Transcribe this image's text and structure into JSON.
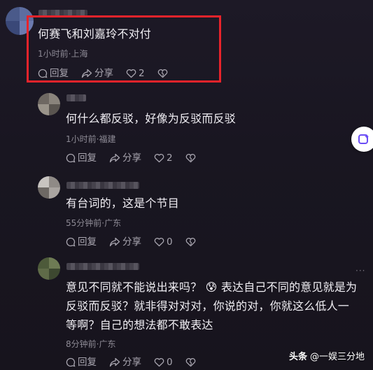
{
  "colors": {
    "background": "#191621",
    "highlight": "#e8232b",
    "meta_text": "#8d8a95",
    "action_text": "#a9a6b0",
    "heart_accent": "#ffffff"
  },
  "comments": [
    {
      "text": "何赛飞和刘嘉玲不对付",
      "meta": "1小时前·上海",
      "reply_label": "回复",
      "share_label": "分享",
      "like_count": "2"
    },
    {
      "text": "何什么都反驳，好像为反驳而反驳",
      "meta": "1小时前·福建",
      "reply_label": "回复",
      "share_label": "分享",
      "like_count": "2"
    },
    {
      "text": "有台词的，这是个节目",
      "meta": "55分钟前·广东",
      "reply_label": "回复",
      "share_label": "分享",
      "like_count": "0"
    },
    {
      "text_line1": "意见不同就不能说出来吗？ 😰 表达自己不同的意见就是为",
      "text_line2": "反驳而反驳？就非得对对对，你说的对，你就这么低人一",
      "text_line3": "等啊？自己的想法都不敢表达",
      "meta": "8分钟前·广东",
      "reply_label": "回复",
      "share_label": "分享",
      "like_count": "0"
    }
  ],
  "more_label": "···",
  "watermark": {
    "brand": "头条",
    "account": "@一娱三分地"
  },
  "icons": [
    "comment-bubble-icon",
    "share-arrow-icon",
    "heart-icon",
    "dislike-heart-icon",
    "ai-assistant-icon"
  ]
}
